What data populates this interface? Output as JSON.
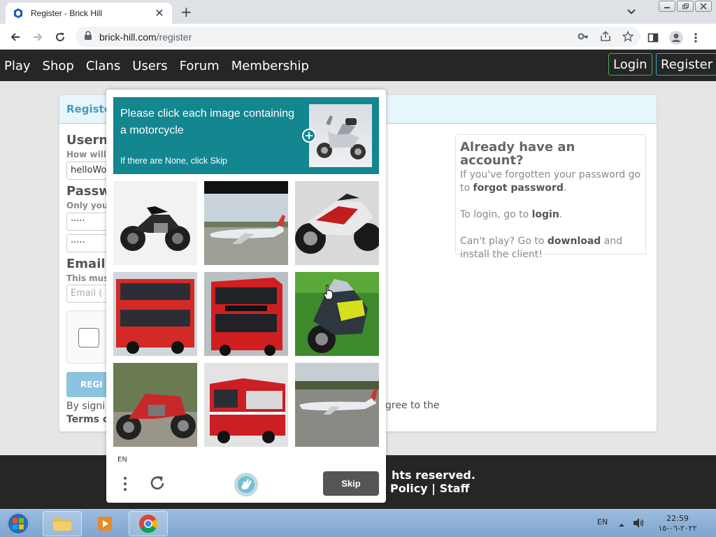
{
  "browser": {
    "tab_title": "Register - Brick Hill",
    "url_host": "brick-hill.com",
    "url_path": "/register"
  },
  "site": {
    "nav": [
      "Play",
      "Shop",
      "Clans",
      "Users",
      "Forum",
      "Membership"
    ],
    "login": "Login",
    "register": "Register"
  },
  "form": {
    "header": "Registe",
    "username_label": "Usern",
    "username_sub": "How will",
    "username_value": "helloWo",
    "password_label": "Passw",
    "password_sub": "Only you",
    "password_value": "·····",
    "password_confirm_value": "·····",
    "email_label": "Email",
    "email_sub": "This mus",
    "email_placeholder": "Email (",
    "submit": "REGI",
    "terms_line1": "By signi",
    "terms_line2": "Terms o",
    "terms_right": "gree to the"
  },
  "aside": {
    "title": "Already have an account?",
    "p1_pre": "If you've forgotten your password go to ",
    "p1_link": "forgot password",
    "p1_post": ".",
    "p2_pre": "To login, go to ",
    "p2_link": "login",
    "p2_post": ".",
    "p3_pre": "Can't play? Go to ",
    "p3_link": "download",
    "p3_post": " and install the client!"
  },
  "footer": {
    "line1": "hts reserved.",
    "line2": "y Policy | Staff"
  },
  "captcha": {
    "prompt": "Please click each image containing a motorcycle",
    "sub": "If there are None, click Skip",
    "language": "EN",
    "skip": "Skip",
    "tiles": [
      "motorcycle",
      "airplane",
      "motorcycle",
      "bus",
      "bus",
      "motorcycle",
      "motorcycle",
      "fire-truck",
      "airplane"
    ]
  },
  "taskbar": {
    "lang": "EN",
    "time": "22:59",
    "date": "٢٠٢٢-٠٦-١٥"
  },
  "colors": {
    "nav_bg": "#262626",
    "captcha_teal": "#138690",
    "login_border": "#43b05c",
    "register_border": "#3aa6c8"
  }
}
